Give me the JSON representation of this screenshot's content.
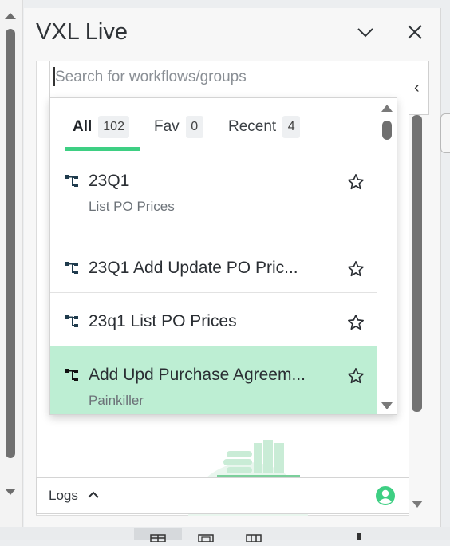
{
  "panel": {
    "title": "VXL Live",
    "minimize_icon": "chevron-down-icon",
    "close_icon": "close-icon",
    "collapse_icon": "chevron-left-icon"
  },
  "search": {
    "placeholder": "Search for workflows/groups",
    "value": ""
  },
  "tabs": [
    {
      "label": "All",
      "count": "102",
      "active": true
    },
    {
      "label": "Fav",
      "count": "0",
      "active": false
    },
    {
      "label": "Recent",
      "count": "4",
      "active": false
    }
  ],
  "items": [
    {
      "name": "23Q1",
      "subtitle": "List PO Prices",
      "icon": "workflow-icon",
      "favorite_icon": "star-icon"
    },
    {
      "name": "23Q1 Add Update PO Pric...",
      "subtitle": "",
      "icon": "workflow-icon",
      "favorite_icon": "star-icon"
    },
    {
      "name": "23q1 List PO Prices",
      "subtitle": "",
      "icon": "workflow-icon",
      "favorite_icon": "star-icon"
    },
    {
      "name": "Add Upd Purchase Agreem...",
      "subtitle": "Painkiller",
      "icon": "workflow-icon",
      "favorite_icon": "star-icon",
      "selected": true
    }
  ],
  "logs": {
    "label": "Logs",
    "toggle_icon": "chevron-up-icon",
    "user_icon": "user-icon"
  },
  "colors": {
    "accent": "#3ecf83",
    "selected_row": "#bdeed3",
    "user_icon": "#3ecf83"
  }
}
